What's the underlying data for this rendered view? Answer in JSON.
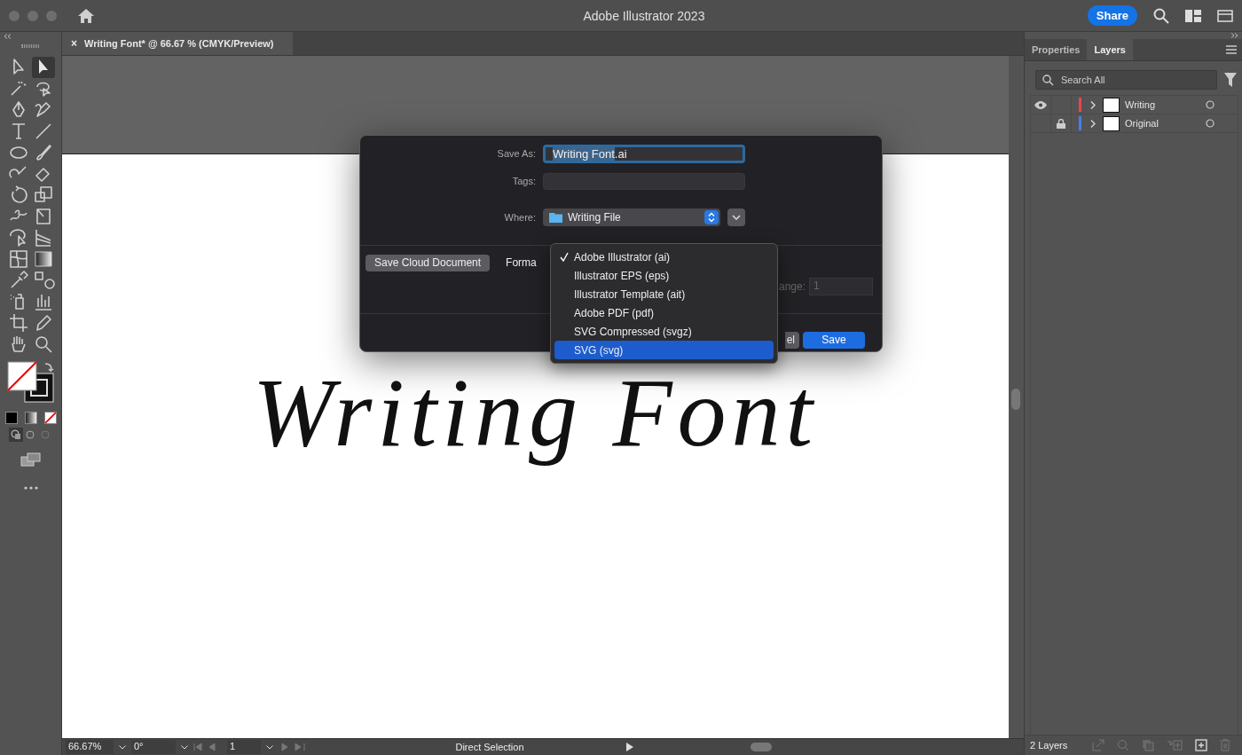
{
  "window": {
    "title": "Adobe Illustrator 2023",
    "share": "Share"
  },
  "document_tab": {
    "close": "×",
    "title": "Writing Font* @ 66.67 % (CMYK/Preview)"
  },
  "tools": [
    {
      "kind": "selection",
      "selected": false
    },
    {
      "kind": "direct",
      "selected": true
    },
    {
      "kind": "wand",
      "selected": false
    },
    {
      "kind": "lasso",
      "selected": false
    },
    {
      "kind": "pen",
      "selected": false
    },
    {
      "kind": "curvature",
      "selected": false
    },
    {
      "kind": "type",
      "selected": false
    },
    {
      "kind": "line",
      "selected": false
    },
    {
      "kind": "ellipse",
      "selected": false
    },
    {
      "kind": "brush",
      "selected": false
    },
    {
      "kind": "shaper",
      "selected": false
    },
    {
      "kind": "eraser",
      "selected": false
    },
    {
      "kind": "rotate",
      "selected": false
    },
    {
      "kind": "scale",
      "selected": false
    },
    {
      "kind": "warp",
      "selected": false
    },
    {
      "kind": "freetransform",
      "selected": false
    },
    {
      "kind": "shapebuilder",
      "selected": false
    },
    {
      "kind": "perspective",
      "selected": false
    },
    {
      "kind": "mesh",
      "selected": false
    },
    {
      "kind": "gradient",
      "selected": false
    },
    {
      "kind": "eyedropper",
      "selected": false
    },
    {
      "kind": "blend",
      "selected": false
    },
    {
      "kind": "spray",
      "selected": false
    },
    {
      "kind": "graph",
      "selected": false
    },
    {
      "kind": "artboard",
      "selected": false
    },
    {
      "kind": "pencil",
      "selected": false
    },
    {
      "kind": "hand",
      "selected": false
    },
    {
      "kind": "zoom",
      "selected": false
    }
  ],
  "artwork_text": "Writing Font",
  "dialog": {
    "save_as_label": "Save As:",
    "save_as_selected": "Writing Font",
    "save_as_rest": ".ai",
    "tags_label": "Tags:",
    "where_label": "Where:",
    "where_value": "Writing File",
    "cloud_button": "Save Cloud Document",
    "format_label": "Forma",
    "range_label": "ange:",
    "range_value": "1",
    "cancel_button": "el",
    "save_button": "Save"
  },
  "format_menu": [
    {
      "label": "Adobe Illustrator (ai)",
      "checked": true,
      "selected": false
    },
    {
      "label": "Illustrator EPS (eps)",
      "checked": false,
      "selected": false
    },
    {
      "label": "Illustrator Template (ait)",
      "checked": false,
      "selected": false
    },
    {
      "label": "Adobe PDF (pdf)",
      "checked": false,
      "selected": false
    },
    {
      "label": "SVG Compressed (svgz)",
      "checked": false,
      "selected": false
    },
    {
      "label": "SVG (svg)",
      "checked": false,
      "selected": true
    }
  ],
  "status_bar": {
    "zoom": "66.67%",
    "rotation": "0°",
    "artboard": "1",
    "tool": "Direct Selection"
  },
  "panel": {
    "tabs": [
      {
        "label": "Properties",
        "selected": false
      },
      {
        "label": "Layers",
        "selected": true
      }
    ],
    "search_placeholder": "Search All",
    "layers": [
      {
        "name": "Writing",
        "visible": true,
        "locked": false,
        "color": "#e8474c"
      },
      {
        "name": "Original",
        "visible": false,
        "locked": true,
        "color": "#4a7bf0"
      }
    ],
    "count": "2 Layers"
  }
}
